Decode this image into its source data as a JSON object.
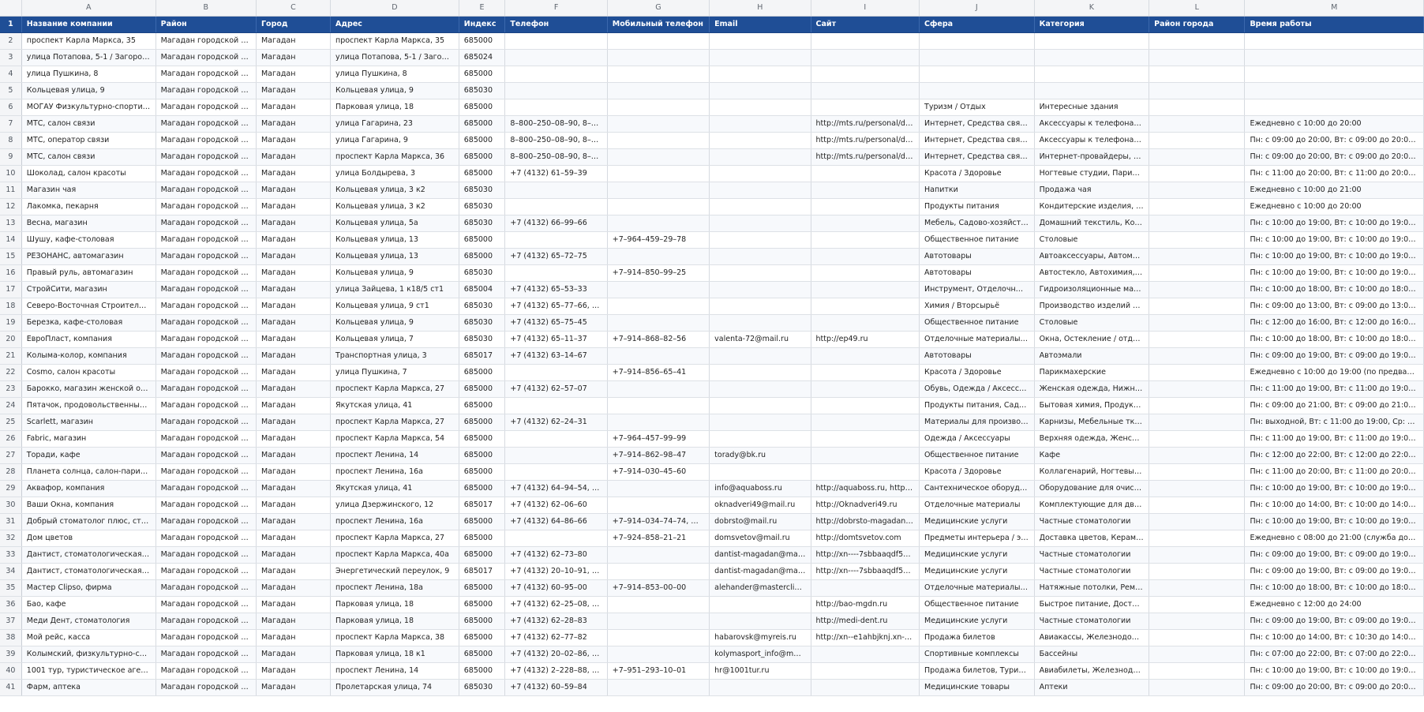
{
  "columns": [
    "",
    "A",
    "B",
    "C",
    "D",
    "E",
    "F",
    "G",
    "H",
    "I",
    "J",
    "K",
    "L",
    "M"
  ],
  "header": {
    "row_number": "1",
    "cells": [
      "Название компании",
      "Район",
      "Город",
      "Адрес",
      "Индекс",
      "Телефон",
      "Мобильный телефон",
      "Email",
      "Сайт",
      "Сфера",
      "Категория",
      "Район города",
      "Время работы"
    ]
  },
  "rows": [
    {
      "n": "2",
      "c": [
        "проспект Карла Маркса, 35",
        "Магадан городской ок...",
        "Магадан",
        "проспект Карла Маркса, 35",
        "685000",
        "",
        "",
        "",
        "",
        "",
        "",
        "",
        ""
      ]
    },
    {
      "n": "3",
      "c": [
        "улица Потапова, 5-1 / Загородный пе...",
        "Магадан городской ок...",
        "Магадан",
        "улица Потапова, 5-1 / Загород...",
        "685024",
        "",
        "",
        "",
        "",
        "",
        "",
        "",
        ""
      ]
    },
    {
      "n": "4",
      "c": [
        "улица Пушкина, 8",
        "Магадан городской ок...",
        "Магадан",
        "улица Пушкина, 8",
        "685000",
        "",
        "",
        "",
        "",
        "",
        "",
        "",
        ""
      ]
    },
    {
      "n": "5",
      "c": [
        "Кольцевая улица, 9",
        "Магадан городской ок...",
        "Магадан",
        "Кольцевая улица, 9",
        "685030",
        "",
        "",
        "",
        "",
        "",
        "",
        "",
        ""
      ]
    },
    {
      "n": "6",
      "c": [
        "МОГАУ Физкультурно-спортивный ко...",
        "Магадан городской ок...",
        "Магадан",
        "Парковая улица, 18",
        "685000",
        "",
        "",
        "",
        "",
        "Туризм / Отдых",
        "Интересные здания",
        "",
        ""
      ]
    },
    {
      "n": "7",
      "c": [
        "МТС, салон связи",
        "Магадан городской ок...",
        "Магадан",
        "улица Гагарина, 23",
        "685000",
        "8–800–250–08–90, 8–8...",
        "",
        "",
        "http://mts.ru/personal/dly...",
        "Интернет, Средства связи, ...",
        "Аксессуары к телефонам, ...",
        "",
        "Ежедневно с 10:00 до 20:00"
      ]
    },
    {
      "n": "8",
      "c": [
        "МТС, оператор связи",
        "Магадан городской ок...",
        "Магадан",
        "улица Гагарина, 9",
        "685000",
        "8–800–250–08–90, 8–8...",
        "",
        "",
        "http://mts.ru/personal/dly...",
        "Интернет, Средства связи, ...",
        "Аксессуары к телефонам, ...",
        "",
        "Пн: с 09:00 до 20:00, Вт: с 09:00 до 20:00, С..."
      ]
    },
    {
      "n": "9",
      "c": [
        "МТС, салон связи",
        "Магадан городской ок...",
        "Магадан",
        "проспект Карла Маркса, 36",
        "685000",
        "8–800–250–08–90, 8–8...",
        "",
        "",
        "http://mts.ru/personal/dly...",
        "Интернет, Средства связи, ...",
        "Интернет-провайдеры, М...",
        "",
        "Пн: с 09:00 до 20:00, Вт: с 09:00 до 20:00, С..."
      ]
    },
    {
      "n": "10",
      "c": [
        "Шоколад, салон красоты",
        "Магадан городской ок...",
        "Магадан",
        "улица Болдырева, 3",
        "685000",
        "+7 (4132) 61–59–39",
        "",
        "",
        "",
        "Красота / Здоровье",
        "Ногтевые студии, Парикма...",
        "",
        "Пн: с 11:00 до 20:00, Вт: с 11:00 до 20:00, С..."
      ]
    },
    {
      "n": "11",
      "c": [
        "Магазин чая",
        "Магадан городской ок...",
        "Магадан",
        "Кольцевая улица, 3 к2",
        "685030",
        "",
        "",
        "",
        "",
        "Напитки",
        "Продажа чая",
        "",
        "Ежедневно с 10:00 до 21:00"
      ]
    },
    {
      "n": "12",
      "c": [
        "Лакомка, пекарня",
        "Магадан городской ок...",
        "Магадан",
        "Кольцевая улица, 3 к2",
        "685030",
        "",
        "",
        "",
        "",
        "Продукты питания",
        "Кондитерские изделия, Хл...",
        "",
        "Ежедневно с 10:00 до 20:00"
      ]
    },
    {
      "n": "13",
      "c": [
        "Весна, магазин",
        "Магадан городской ок...",
        "Магадан",
        "Кольцевая улица, 5а",
        "685030",
        "+7 (4132) 66–99–66",
        "",
        "",
        "",
        "Мебель, Садово-хозяйстве...",
        "Домашний текстиль, Корп...",
        "",
        "Пн: с 10:00 до 19:00, Вт: с 10:00 до 19:00, С..."
      ]
    },
    {
      "n": "14",
      "c": [
        "Шушу, кафе-столовая",
        "Магадан городской ок...",
        "Магадан",
        "Кольцевая улица, 13",
        "685000",
        "",
        "+7–964–459–29–78",
        "",
        "",
        "Общественное питание",
        "Столовые",
        "",
        "Пн: с 10:00 до 19:00, Вт: с 10:00 до 19:00, С..."
      ]
    },
    {
      "n": "15",
      "c": [
        "РЕЗОНАНС, автомагазин",
        "Магадан городской ок...",
        "Магадан",
        "Кольцевая улица, 13",
        "685000",
        "+7 (4132) 65–72–75",
        "",
        "",
        "",
        "Автотовары",
        "Автоаксессуары, Автомоб...",
        "",
        "Пн: с 10:00 до 19:00, Вт: с 10:00 до 19:00, С..."
      ]
    },
    {
      "n": "16",
      "c": [
        "Правый руль, автомагазин",
        "Магадан городской ок...",
        "Магадан",
        "Кольцевая улица, 9",
        "685030",
        "",
        "+7–914–850–99–25",
        "",
        "",
        "Автотовары",
        "Автостекло, Автохимия, За...",
        "",
        "Пн: с 10:00 до 19:00, Вт: с 10:00 до 19:00, С..."
      ]
    },
    {
      "n": "17",
      "c": [
        "СтройСити, магазин",
        "Магадан городской ок...",
        "Магадан",
        "улица Зайцева, 1 к18/5 ст1",
        "685004",
        "+7 (4132) 65–53–33",
        "",
        "",
        "",
        "Инструмент, Отделочные ...",
        "Гидроизоляционные мате...",
        "",
        "Пн: с 10:00 до 18:00, Вт: с 10:00 до 18:00, С..."
      ]
    },
    {
      "n": "18",
      "c": [
        "Северо-Восточная Строительная Ком...",
        "Магадан городской ок...",
        "Магадан",
        "Кольцевая улица, 9 ст1",
        "685030",
        "+7 (4132) 65–77–66, +7...",
        "",
        "",
        "",
        "Химия / Вторсырьё",
        "Производство изделий из ...",
        "",
        "Пн: с 09:00 до 13:00, Вт: с 09:00 до 13:00, С..."
      ]
    },
    {
      "n": "19",
      "c": [
        "Березка, кафе-столовая",
        "Магадан городской ок...",
        "Магадан",
        "Кольцевая улица, 9",
        "685030",
        "+7 (4132) 65–75–45",
        "",
        "",
        "",
        "Общественное питание",
        "Столовые",
        "",
        "Пн: с 12:00 до 16:00, Вт: с 12:00 до 16:00, С..."
      ]
    },
    {
      "n": "20",
      "c": [
        "ЕвроПласт, компания",
        "Магадан городской ок...",
        "Магадан",
        "Кольцевая улица, 7",
        "685030",
        "+7 (4132) 65–11–37",
        "+7–914–868–82–56",
        "valenta-72@mail.ru",
        "http://ep49.ru",
        "Отделочные материалы, С...",
        "Окна, Остекление / отделк...",
        "",
        "Пн: с 10:00 до 18:00, Вт: с 10:00 до 18:00, С..."
      ]
    },
    {
      "n": "21",
      "c": [
        "Колыма-колор, компания",
        "Магадан городской ок...",
        "Магадан",
        "Транспортная улица, 3",
        "685017",
        "+7 (4132) 63–14–67",
        "",
        "",
        "",
        "Автотовары",
        "Автоэмали",
        "",
        "Пн: с 09:00 до 19:00, Вт: с 09:00 до 19:00, С..."
      ]
    },
    {
      "n": "22",
      "c": [
        "Cosmo, салон красоты",
        "Магадан городской ок...",
        "Магадан",
        "улица Пушкина, 7",
        "685000",
        "",
        "+7–914–856–65–41",
        "",
        "",
        "Красота / Здоровье",
        "Парикмахерские",
        "",
        "Ежедневно с 10:00 до 19:00 (по предвари..."
      ]
    },
    {
      "n": "23",
      "c": [
        "Барокко, магазин женской одежды и ...",
        "Магадан городской ок...",
        "Магадан",
        "проспект Карла Маркса, 27",
        "685000",
        "+7 (4132) 62–57–07",
        "",
        "",
        "",
        "Обувь, Одежда / Аксессуа...",
        "Женская одежда, Нижнее ...",
        "",
        "Пн: с 11:00 до 19:00, Вт: с 11:00 до 19:00, С..."
      ]
    },
    {
      "n": "24",
      "c": [
        "Пятачок, продовольственный магазин",
        "Магадан городской ок...",
        "Магадан",
        "Якутская улица, 41",
        "685000",
        "",
        "",
        "",
        "",
        "Продукты питания, Садов...",
        "Бытовая химия, Продуктов...",
        "",
        "Пн: с 09:00 до 21:00, Вт: с 09:00 до 21:00, С..."
      ]
    },
    {
      "n": "25",
      "c": [
        "Scarlett, магазин",
        "Магадан городской ок...",
        "Магадан",
        "проспект Карла Маркса, 27",
        "685000",
        "+7 (4132) 62–24–31",
        "",
        "",
        "",
        "Материалы для производс...",
        "Карнизы, Мебельные ткан...",
        "",
        "Пн: выходной, Вт: с 11:00 до 19:00, Ср: с 1..."
      ]
    },
    {
      "n": "26",
      "c": [
        "Fabric, магазин",
        "Магадан городской ок...",
        "Магадан",
        "проспект Карла Маркса, 54",
        "685000",
        "",
        "+7–964–457–99–99",
        "",
        "",
        "Одежда / Аксессуары",
        "Верхняя одежда, Женская ...",
        "",
        "Пн: с 11:00 до 19:00, Вт: с 11:00 до 19:00, С..."
      ]
    },
    {
      "n": "27",
      "c": [
        "Торади, кафе",
        "Магадан городской ок...",
        "Магадан",
        "проспект Ленина, 14",
        "685000",
        "",
        "+7–914–862–98–47",
        "torady@bk.ru",
        "",
        "Общественное питание",
        "Кафе",
        "",
        "Пн: с 12:00 до 22:00, Вт: с 12:00 до 22:00, С..."
      ]
    },
    {
      "n": "28",
      "c": [
        "Планета солнца, салон-парикмахерск...",
        "Магадан городской ок...",
        "Магадан",
        "проспект Ленина, 16а",
        "685000",
        "",
        "+7–914–030–45–60",
        "",
        "",
        "Красота / Здоровье",
        "Коллагенарий, Ногтевые с...",
        "",
        "Пн: с 11:00 до 20:00, Вт: с 11:00 до 20:00, С..."
      ]
    },
    {
      "n": "29",
      "c": [
        "Аквафор, компания",
        "Магадан городской ок...",
        "Магадан",
        "Якутская улица, 41",
        "685000",
        "+7 (4132) 64–94–54, +7...",
        "",
        "info@aquaboss.ru",
        "http://aquaboss.ru, http://...",
        "Сантехническое оборудов...",
        "Оборудование для очистк...",
        "",
        "Пн: с 10:00 до 19:00, Вт: с 10:00 до 19:00, С..."
      ]
    },
    {
      "n": "30",
      "c": [
        "Ваши Окна, компания",
        "Магадан городской ок...",
        "Магадан",
        "улица Дзержинского, 12",
        "685017",
        "+7 (4132) 62–06–60",
        "",
        "oknadveri49@mail.ru",
        "http://Oknadveri49.ru",
        "Отделочные материалы",
        "Комплектующие для двер...",
        "",
        "Пн: с 10:00 до 14:00, Вт: с 10:00 до 14:00, С..."
      ]
    },
    {
      "n": "31",
      "c": [
        "Добрый стоматолог плюс, стоматоло...",
        "Магадан городской ок...",
        "Магадан",
        "проспект Ленина, 16а",
        "685000",
        "+7 (4132) 64–86–66",
        "+7–914–034–74–74, +7...",
        "dobrsto@mail.ru",
        "http://dobrsto-magadan.ru",
        "Медицинские услуги",
        "Частные стоматологии",
        "",
        "Пн: с 10:00 до 19:00, Вт: с 10:00 до 19:00, С..."
      ]
    },
    {
      "n": "32",
      "c": [
        "Дом цветов",
        "Магадан городской ок...",
        "Магадан",
        "проспект Карла Маркса, 27",
        "685000",
        "",
        "+7–924–858–21–21",
        "domsvetov@mail.ru",
        "http://domtsvetov.com",
        "Предметы интерьера / экс...",
        "Доставка цветов, Керамич...",
        "",
        "Ежедневно с 08:00 до 21:00 (служба дост..."
      ]
    },
    {
      "n": "33",
      "c": [
        "Дантист, стоматологическая поликли...",
        "Магадан городской ок...",
        "Магадан",
        "проспект Карла Маркса, 40а",
        "685000",
        "+7 (4132) 62–73–80",
        "",
        "dantist-magadan@mail....",
        "http://xn----7sbbaaqdf5a...",
        "Медицинские услуги",
        "Частные стоматологии",
        "",
        "Пн: с 09:00 до 19:00, Вт: с 09:00 до 19:00, С..."
      ]
    },
    {
      "n": "34",
      "c": [
        "Дантист, стоматологическая поликли...",
        "Магадан городской ок...",
        "Магадан",
        "Энергетический переулок, 9",
        "685017",
        "+7 (4132) 20–10–91, +7...",
        "",
        "dantist-magadan@mail....",
        "http://xn----7sbbaaqdf5a...",
        "Медицинские услуги",
        "Частные стоматологии",
        "",
        "Пн: с 09:00 до 19:00, Вт: с 09:00 до 19:00, С..."
      ]
    },
    {
      "n": "35",
      "c": [
        "Мастер Clipso, фирма",
        "Магадан городской ок...",
        "Магадан",
        "проспект Ленина, 18а",
        "685000",
        "+7 (4132) 60–95–00",
        "+7–914–853–00–00",
        "alehander@masterclips...",
        "",
        "Отделочные материалы, С...",
        "Натяжные потолки, Ремон...",
        "",
        "Пн: с 10:00 до 18:00, Вт: с 10:00 до 18:00, С..."
      ]
    },
    {
      "n": "36",
      "c": [
        "Бао, кафе",
        "Магадан городской ок...",
        "Магадан",
        "Парковая улица, 18",
        "685000",
        "+7 (4132) 62–25–08, +7...",
        "",
        "",
        "http://bao-mgdn.ru",
        "Общественное питание",
        "Быстрое питание, Доставк...",
        "",
        "Ежедневно с 12:00 до 24:00"
      ]
    },
    {
      "n": "37",
      "c": [
        "Меди Дент, стоматология",
        "Магадан городской ок...",
        "Магадан",
        "Парковая улица, 18",
        "685000",
        "+7 (4132) 62–28–83",
        "",
        "",
        "http://medi-dent.ru",
        "Медицинские услуги",
        "Частные стоматологии",
        "",
        "Пн: с 09:00 до 19:00, Вт: с 09:00 до 19:00, С..."
      ]
    },
    {
      "n": "38",
      "c": [
        "Мой рейс, касса",
        "Магадан городской ок...",
        "Магадан",
        "проспект Карла Маркса, 38",
        "685000",
        "+7 (4132) 62–77–82",
        "",
        "habarovsk@myreis.ru",
        "http://xn--e1ahbjknj.xn--p...",
        "Продажа билетов",
        "Авиакассы, Железнодоро...",
        "",
        "Пн: с 10:00 до 14:00, Вт: с 10:30 до 14:00, С..."
      ]
    },
    {
      "n": "39",
      "c": [
        "Колымский, физкультурно-спортивн...",
        "Магадан городской ок...",
        "Магадан",
        "Парковая улица, 18 к1",
        "685000",
        "+7 (4132) 20–02–86, +7...",
        "",
        "kolymasport_info@mail....",
        "",
        "Спортивные комплексы",
        "Бассейны",
        "",
        "Пн: с 07:00 до 22:00, Вт: с 07:00 до 22:00, С..."
      ]
    },
    {
      "n": "40",
      "c": [
        "1001 тур, туристическое агентство",
        "Магадан городской ок...",
        "Магадан",
        "проспект Ленина, 14",
        "685000",
        "+7 (4132) 2–228–88, +7...",
        "+7–951–293–10–01",
        "hr@1001tur.ru",
        "",
        "Продажа билетов, Туризм ...",
        "Авиабилеты, Железнодоро...",
        "",
        "Пн: с 10:00 до 19:00, Вт: с 10:00 до 19:00, С..."
      ]
    },
    {
      "n": "41",
      "c": [
        "Фарм, аптека",
        "Магадан городской ок...",
        "Магадан",
        "Пролетарская улица, 74",
        "685030",
        "+7 (4132) 60–59–84",
        "",
        "",
        "",
        "Медицинские товары",
        "Аптеки",
        "",
        "Пн: с 09:00 до 20:00, Вт: с 09:00 до 20:00, С..."
      ]
    }
  ]
}
